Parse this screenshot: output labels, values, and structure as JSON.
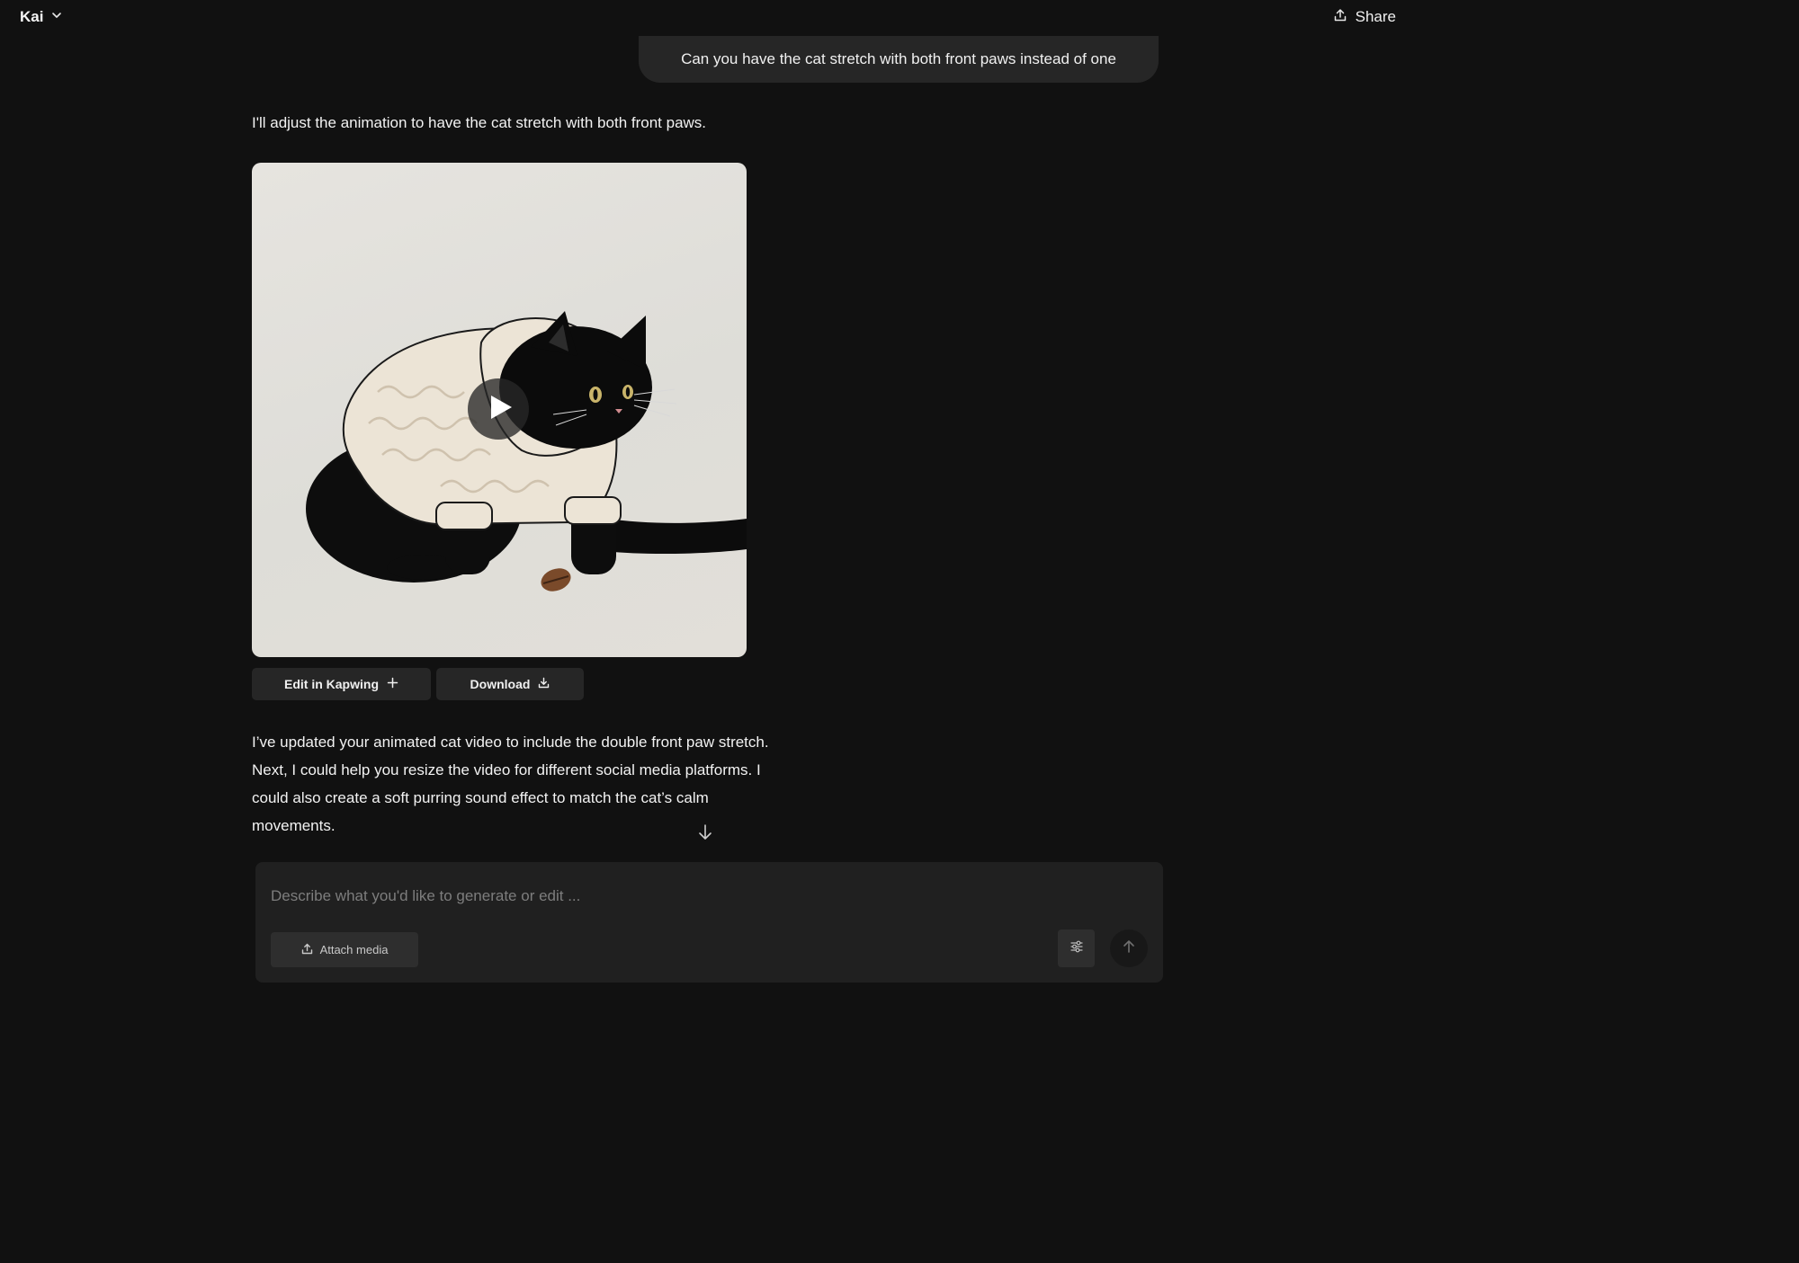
{
  "header": {
    "model_name": "Kai",
    "model_menu_icon": "chevron-down-icon",
    "share_label": "Share",
    "share_icon": "share-upload-icon"
  },
  "conversation": {
    "user_message": "Can you have the cat stretch with both front paws instead of one",
    "assistant_intro": "I'll adjust the animation to have the cat stretch with both front paws.",
    "video": {
      "play_icon": "play-icon"
    },
    "actions": {
      "edit_label": "Edit in Kapwing",
      "edit_icon": "plus-icon",
      "download_label": "Download",
      "download_icon": "download-icon"
    },
    "assistant_reply": [
      "I’ve updated your animated cat video to include the double front paw stretch.",
      "Next, I could help you resize the video for different social media platforms. I",
      "could also create a soft purring sound effect to match the cat’s calm",
      "movements."
    ]
  },
  "composer": {
    "placeholder": "Describe what you'd like to generate or edit ...",
    "value": "",
    "attach_label": "Attach media",
    "attach_icon": "upload-icon",
    "settings_icon": "sliders-icon",
    "send_icon": "arrow-up-icon"
  },
  "colors": {
    "background": "#111111",
    "bubble": "#262626",
    "composer": "#202020",
    "button": "#262626"
  }
}
